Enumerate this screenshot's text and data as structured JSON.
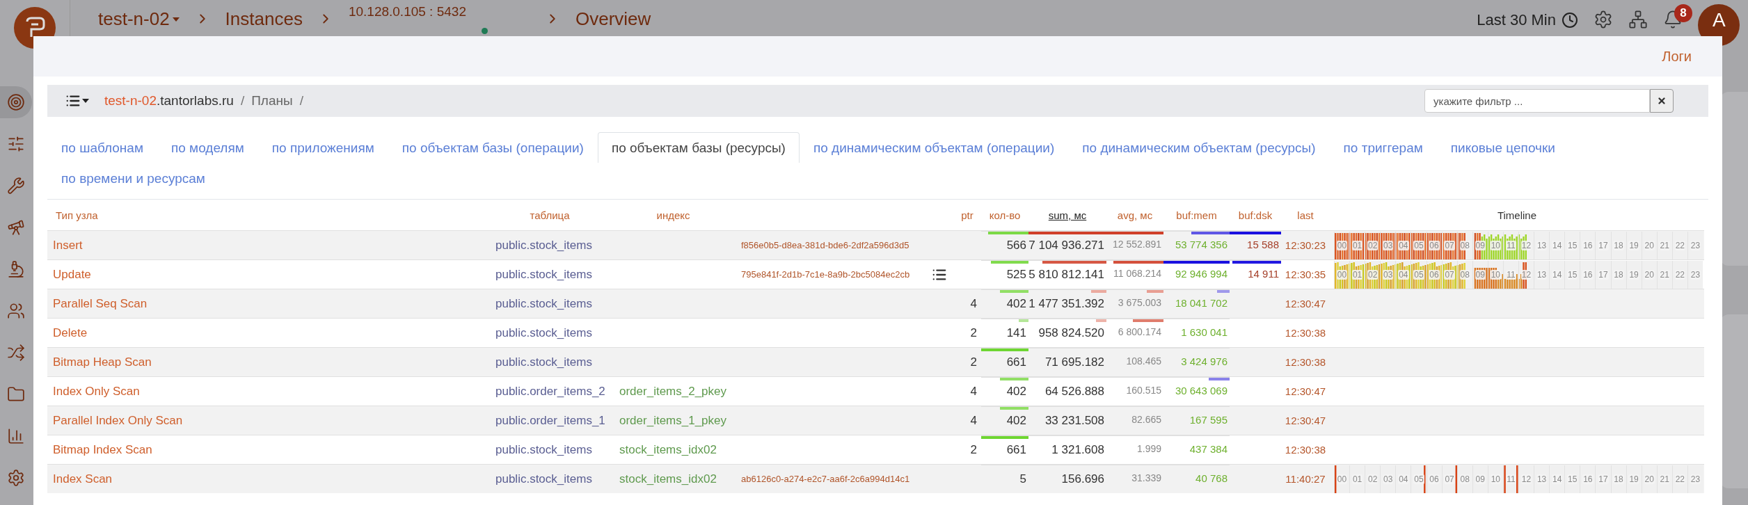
{
  "app": {
    "project": "test-n-02",
    "breadcrumbs": [
      "Instances",
      "10.128.0.105 : 5432",
      "Overview"
    ],
    "period": "Last 30 Min",
    "notifications": "8",
    "avatar": "A",
    "sidebar": [
      {
        "selected": true
      },
      {
        "selected": false
      },
      {
        "selected": false
      },
      {
        "selected": false
      },
      {
        "selected": false
      },
      {
        "selected": false
      },
      {
        "selected": false
      },
      {
        "selected": false
      },
      {
        "selected": false
      },
      {
        "selected": false
      }
    ]
  },
  "modal": {
    "link": "Логи",
    "breadcrumb": {
      "host_name": "test-n-02",
      "host_domain": ".tantorlabs.ru",
      "separator_1": "/",
      "section": "Планы",
      "separator_2": "/"
    },
    "filter": {
      "placeholder": "укажите фильтр ..."
    },
    "tabs": [
      {
        "label": "по шаблонам",
        "selected": false
      },
      {
        "label": "по моделям",
        "selected": false
      },
      {
        "label": "по приложениям",
        "selected": false
      },
      {
        "label": "по объектам базы (операции)",
        "selected": false
      },
      {
        "label": "по объектам базы (ресурсы)",
        "selected": true
      },
      {
        "label": "по динамическим объектам (операции)",
        "selected": false
      },
      {
        "label": "по динамическим объектам (ресурсы)",
        "selected": false
      },
      {
        "label": "по триггерам",
        "selected": false
      },
      {
        "label": "пиковые цепочки",
        "selected": false
      },
      {
        "label": "по времени и ресурсам",
        "selected": false
      }
    ],
    "table": {
      "columns": [
        {
          "label": "Тип узла",
          "sorted": false
        },
        {
          "label": "таблица",
          "sorted": false
        },
        {
          "label": "индекс",
          "sorted": false
        },
        {
          "label": "ptr",
          "sorted": false
        },
        {
          "label": "кол-во",
          "sorted": false
        },
        {
          "label": "sum, мс",
          "sorted": true
        },
        {
          "label": "avg, мс",
          "sorted": false
        },
        {
          "label": "buf:mem",
          "sorted": false
        },
        {
          "label": "buf:dsk",
          "sorted": false
        },
        {
          "label": "last",
          "sorted": false
        },
        {
          "label": "Timeline",
          "sorted": false
        }
      ],
      "rows": [
        {
          "node": "Insert",
          "table": "public.stock_items",
          "query_id": "f856e0b5-d8ea-381d-bde6-2df2a596d3d5",
          "details": false,
          "count": {
            "text": "566",
            "level": 0.85
          },
          "sum": {
            "text": "7 104 936.271",
            "level": 1
          },
          "avg": {
            "text": "12 552.891",
            "level": 1
          },
          "buf_mem": {
            "text": "53 774 356",
            "level": 0.58
          },
          "buf_dsk": {
            "text": "15 588",
            "level": 1
          },
          "last": "12:30:23",
          "timeline": {
            "kind": "heavy",
            "hours": [
              "00",
              "01",
              "02",
              "03",
              "04",
              "05",
              "06",
              "07",
              "08",
              "09",
              "10",
              "11",
              "12",
              "13",
              "14",
              "15",
              "16",
              "17",
              "18",
              "19",
              "20",
              "21",
              "22",
              "23"
            ]
          }
        },
        {
          "node": "Update",
          "table": "public.stock_items",
          "query_id": "795e841f-2d1b-7c1e-8a9b-2bc5084ec2cb",
          "details": true,
          "count": {
            "text": "525",
            "level": 0.79
          },
          "sum": {
            "text": "5 810 812.141",
            "level": 0.82
          },
          "avg": {
            "text": "11 068.214",
            "level": 0.88
          },
          "buf_mem": {
            "text": "92 946 994",
            "level": 1
          },
          "buf_dsk": {
            "text": "14 911",
            "level": 0.95
          },
          "last": "12:30:35",
          "timeline": {
            "kind": "mixed",
            "hours": [
              "00",
              "01",
              "02",
              "03",
              "04",
              "05",
              "06",
              "07",
              "08",
              "09",
              "10",
              "11",
              "12",
              "13",
              "14",
              "15",
              "16",
              "17",
              "18",
              "19",
              "20",
              "21",
              "22",
              "23"
            ]
          }
        },
        {
          "node": "Parallel Seq Scan",
          "table": "public.stock_items",
          "details": false,
          "ptr": "4",
          "count": {
            "text": "402",
            "level": 0.61
          },
          "sum": {
            "text": "1 477 351.392",
            "level": 0.2
          },
          "avg": {
            "text": "3 675.003",
            "level": 0.29
          },
          "buf_mem": {
            "text": "18 041 702",
            "level": 0.19
          },
          "last": "12:30:47"
        },
        {
          "node": "Delete",
          "table": "public.stock_items",
          "details": false,
          "ptr": "2",
          "count": {
            "text": "141",
            "level": 0.21
          },
          "sum": {
            "text": "958 824.520",
            "level": 0.13
          },
          "avg": {
            "text": "6 800.174",
            "level": 0.54
          },
          "buf_mem": {
            "text": "1 630 041"
          },
          "last": "12:30:38"
        },
        {
          "node": "Bitmap Heap Scan",
          "table": "public.stock_items",
          "details": false,
          "ptr": "2",
          "count": {
            "text": "661",
            "level": 1
          },
          "sum": {
            "text": "71 695.182"
          },
          "avg": {
            "text": "108.465"
          },
          "buf_mem": {
            "text": "3 424 976"
          },
          "last": "12:30:38"
        },
        {
          "node": "Index Only Scan",
          "table": "public.order_items_2",
          "index": "order_items_2_pkey",
          "details": false,
          "ptr": "4",
          "count": {
            "text": "402",
            "level": 0.61
          },
          "sum": {
            "text": "64 526.888"
          },
          "avg": {
            "text": "160.515"
          },
          "buf_mem": {
            "text": "30 643 069",
            "level": 0.32
          },
          "last": "12:30:47"
        },
        {
          "node": "Parallel Index Only Scan",
          "table": "public.order_items_1",
          "index": "order_items_1_pkey",
          "details": false,
          "ptr": "4",
          "count": {
            "text": "402",
            "level": 0.61
          },
          "sum": {
            "text": "33 231.508"
          },
          "avg": {
            "text": "82.665"
          },
          "buf_mem": {
            "text": "167 595"
          },
          "last": "12:30:47"
        },
        {
          "node": "Bitmap Index Scan",
          "table": "public.stock_items",
          "index": "stock_items_idx02",
          "details": false,
          "ptr": "2",
          "count": {
            "text": "661",
            "level": 1
          },
          "sum": {
            "text": "1 321.608"
          },
          "avg": {
            "text": "1.999"
          },
          "buf_mem": {
            "text": "437 384"
          },
          "last": "12:30:38"
        },
        {
          "node": "Index Scan",
          "table": "public.stock_items",
          "index": "stock_items_idx02",
          "query_id": "ab6126c0-a274-e2c7-aa6f-2c6a994d14c1",
          "details": false,
          "count": {
            "text": "5"
          },
          "sum": {
            "text": "156.696"
          },
          "avg": {
            "text": "31.339"
          },
          "buf_mem": {
            "text": "40 768"
          },
          "last": "11:40:27",
          "timeline": {
            "kind": "sparse",
            "hours": [
              "00",
              "01",
              "02",
              "03",
              "04",
              "05",
              "06",
              "07",
              "08",
              "09",
              "10",
              "11",
              "12",
              "13",
              "14",
              "15",
              "16",
              "17",
              "18",
              "19",
              "20",
              "21",
              "22",
              "23"
            ]
          }
        }
      ]
    }
  }
}
